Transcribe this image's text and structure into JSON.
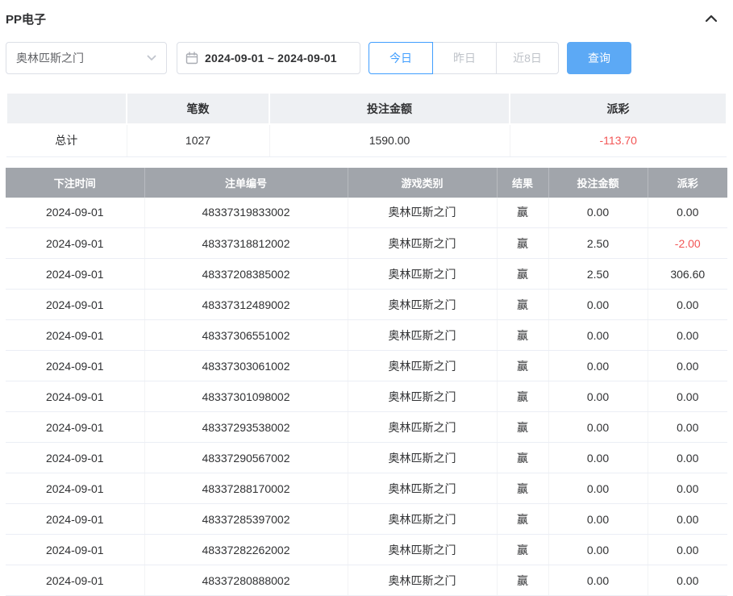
{
  "colors": {
    "accent": "#409eff",
    "search_button": "#5ca9f5",
    "negative": "#f25555",
    "table_header_bg": "#a1a5ab",
    "summary_header_bg": "#eef0f3"
  },
  "header": {
    "title": "PP电子"
  },
  "filters": {
    "game_select": {
      "value": "奥林匹斯之门"
    },
    "date_range": {
      "value": "2024-09-01 ~ 2024-09-01"
    },
    "quick_buttons": [
      {
        "label": "今日",
        "active": true
      },
      {
        "label": "昨日",
        "active": false
      },
      {
        "label": "近8日",
        "active": false
      }
    ],
    "search_label": "查询"
  },
  "summary": {
    "columns": [
      "",
      "笔数",
      "投注金额",
      "派彩"
    ],
    "row_label": "总计",
    "count": "1027",
    "bet_amount": "1590.00",
    "payout": "-113.70"
  },
  "table": {
    "columns": [
      "下注时间",
      "注单编号",
      "游戏类别",
      "结果",
      "投注金额",
      "派彩"
    ],
    "rows": [
      {
        "time": "2024-09-01",
        "order_id": "48337319833002",
        "game": "奥林匹斯之门",
        "result": "赢",
        "bet": "0.00",
        "payout": "0.00"
      },
      {
        "time": "2024-09-01",
        "order_id": "48337318812002",
        "game": "奥林匹斯之门",
        "result": "赢",
        "bet": "2.50",
        "payout": "-2.00"
      },
      {
        "time": "2024-09-01",
        "order_id": "48337208385002",
        "game": "奥林匹斯之门",
        "result": "赢",
        "bet": "2.50",
        "payout": "306.60"
      },
      {
        "time": "2024-09-01",
        "order_id": "48337312489002",
        "game": "奥林匹斯之门",
        "result": "赢",
        "bet": "0.00",
        "payout": "0.00"
      },
      {
        "time": "2024-09-01",
        "order_id": "48337306551002",
        "game": "奥林匹斯之门",
        "result": "赢",
        "bet": "0.00",
        "payout": "0.00"
      },
      {
        "time": "2024-09-01",
        "order_id": "48337303061002",
        "game": "奥林匹斯之门",
        "result": "赢",
        "bet": "0.00",
        "payout": "0.00"
      },
      {
        "time": "2024-09-01",
        "order_id": "48337301098002",
        "game": "奥林匹斯之门",
        "result": "赢",
        "bet": "0.00",
        "payout": "0.00"
      },
      {
        "time": "2024-09-01",
        "order_id": "48337293538002",
        "game": "奥林匹斯之门",
        "result": "赢",
        "bet": "0.00",
        "payout": "0.00"
      },
      {
        "time": "2024-09-01",
        "order_id": "48337290567002",
        "game": "奥林匹斯之门",
        "result": "赢",
        "bet": "0.00",
        "payout": "0.00"
      },
      {
        "time": "2024-09-01",
        "order_id": "48337288170002",
        "game": "奥林匹斯之门",
        "result": "赢",
        "bet": "0.00",
        "payout": "0.00"
      },
      {
        "time": "2024-09-01",
        "order_id": "48337285397002",
        "game": "奥林匹斯之门",
        "result": "赢",
        "bet": "0.00",
        "payout": "0.00"
      },
      {
        "time": "2024-09-01",
        "order_id": "48337282262002",
        "game": "奥林匹斯之门",
        "result": "赢",
        "bet": "0.00",
        "payout": "0.00"
      },
      {
        "time": "2024-09-01",
        "order_id": "48337280888002",
        "game": "奥林匹斯之门",
        "result": "赢",
        "bet": "0.00",
        "payout": "0.00"
      }
    ]
  }
}
